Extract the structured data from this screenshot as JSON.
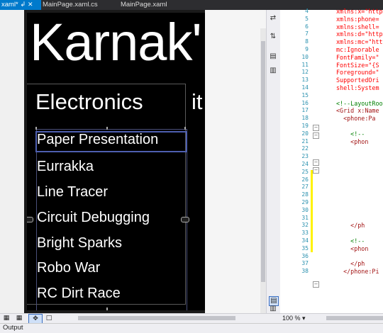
{
  "tabs": [
    {
      "label": "xaml*",
      "pin": "↲",
      "close": "✕"
    },
    {
      "label": "MainPage.xaml.cs"
    },
    {
      "label": "MainPage.xaml"
    }
  ],
  "phone": {
    "app_title": "Karnak'",
    "pivot_header": "Electronics",
    "pivot_next_header": "it",
    "list_items": [
      "Paper Presentation",
      "Eurrakka",
      "Line Tracer",
      "Circuit Debugging",
      "Bright Sparks",
      "Robo War",
      "RC Dirt Race"
    ]
  },
  "code": {
    "line_numbers": [
      "4",
      "5",
      "6",
      "7",
      "8",
      "9",
      "10",
      "11",
      "12",
      "13",
      "14",
      "15",
      "16",
      "17",
      "18",
      "19",
      "20",
      "21",
      "22",
      "23",
      "24",
      "25",
      "26",
      "27",
      "28",
      "29",
      "30",
      "31",
      "32",
      "33",
      "34",
      "35",
      "36",
      "37",
      "38"
    ],
    "lines": [
      {
        "text": "xmlns:x=\"http",
        "color": "#ff0000"
      },
      {
        "text": "xmlns:phone=",
        "color": "#ff0000"
      },
      {
        "text": "xmlns:shell=",
        "color": "#ff0000"
      },
      {
        "text": "xmlns:d=\"http",
        "color": "#ff0000"
      },
      {
        "text": "xmlns:mc=\"htt",
        "color": "#ff0000"
      },
      {
        "text": "mc:Ignorable",
        "color": "#ff0000"
      },
      {
        "text": "FontFamily=\"",
        "color": "#ff0000"
      },
      {
        "text": "FontSize=\"{S",
        "color": "#ff0000"
      },
      {
        "text": "Foreground=\"",
        "color": "#ff0000"
      },
      {
        "text": "SupportedOri",
        "color": "#ff0000"
      },
      {
        "text": "shell:System",
        "color": "#ff0000"
      },
      {
        "text": "",
        "color": "#000000"
      },
      {
        "text": "<!--LayoutRoo",
        "color": "#008000"
      },
      {
        "text": "<Grid x:Name",
        "color": "#a31515"
      },
      {
        "text": "  <phone:Pa",
        "color": "#a31515"
      },
      {
        "text": "",
        "color": "#000000"
      },
      {
        "text": "    <!--",
        "color": "#008000"
      },
      {
        "text": "    <phon",
        "color": "#a31515"
      },
      {
        "text": "",
        "color": "#000000"
      },
      {
        "text": "",
        "color": "#000000"
      },
      {
        "text": "",
        "color": "#000000"
      },
      {
        "text": "",
        "color": "#000000"
      },
      {
        "text": "",
        "color": "#000000"
      },
      {
        "text": "",
        "color": "#000000"
      },
      {
        "text": "",
        "color": "#000000"
      },
      {
        "text": "",
        "color": "#000000"
      },
      {
        "text": "",
        "color": "#000000"
      },
      {
        "text": "",
        "color": "#000000"
      },
      {
        "text": "    </ph",
        "color": "#a31515"
      },
      {
        "text": "",
        "color": "#000000"
      },
      {
        "text": "    <!--",
        "color": "#008000"
      },
      {
        "text": "    <phon",
        "color": "#a31515"
      },
      {
        "text": "",
        "color": "#000000"
      },
      {
        "text": "    </ph",
        "color": "#a31515"
      },
      {
        "text": "  </phone:Pi",
        "color": "#a31515"
      }
    ]
  },
  "status": {
    "zoom": "100 %",
    "output_label": "Output"
  },
  "icons": {
    "pan": "✥",
    "comment": "□",
    "grid": "▦",
    "swap": "⇄",
    "sync": "⇅",
    "split_h": "▤",
    "split_v": "▥",
    "zoom_drop": "▾"
  }
}
